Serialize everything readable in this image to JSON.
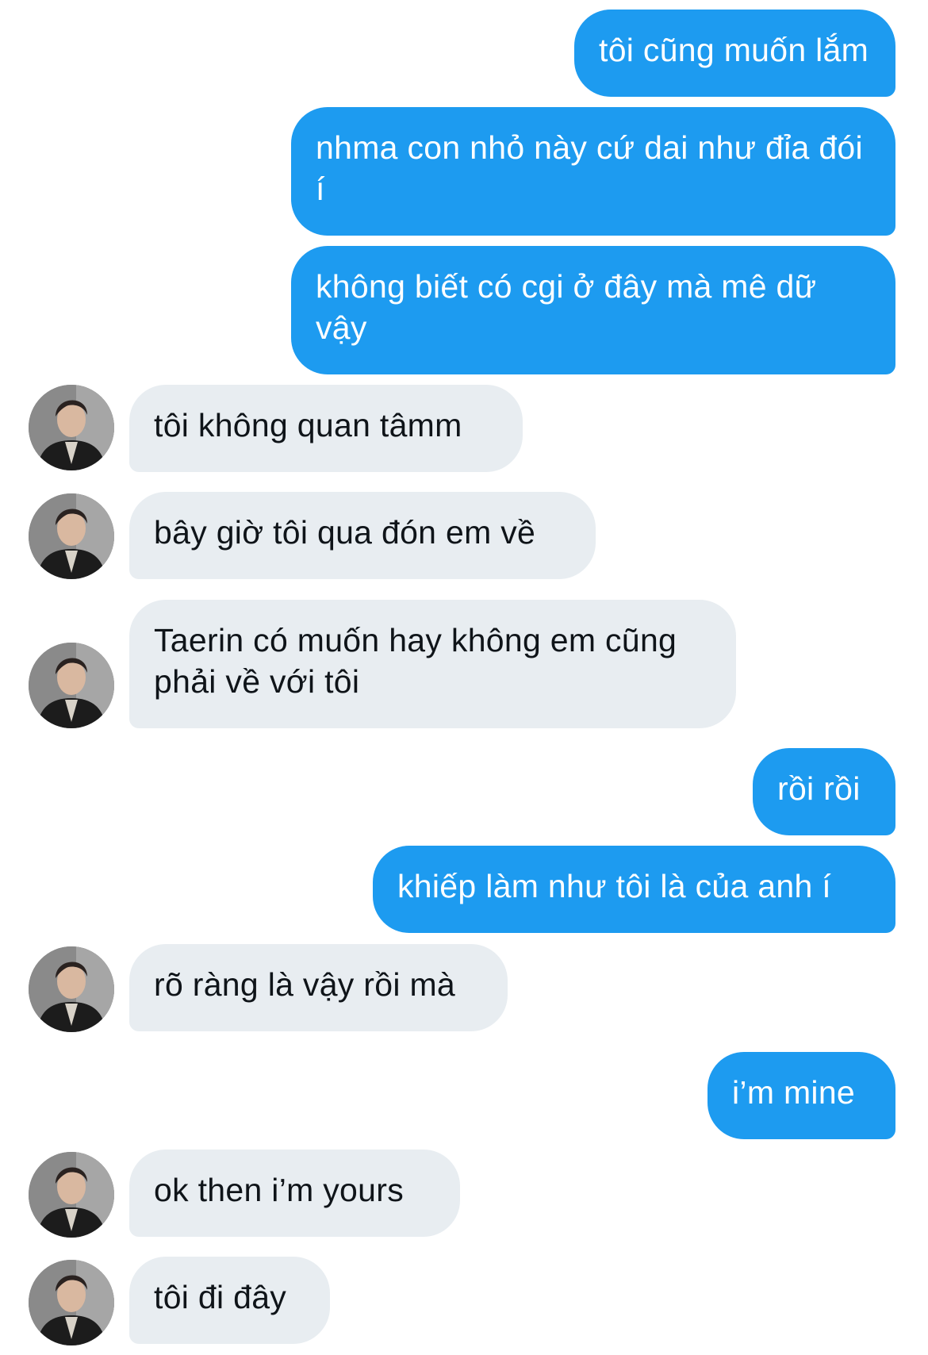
{
  "conversation": {
    "messages": [
      {
        "from": "me",
        "text": "tôi cũng muốn lắm"
      },
      {
        "from": "me",
        "text": "nhma con nhỏ này cứ dai như đỉa đói í"
      },
      {
        "from": "me",
        "text": "không biết có cgi ở đây mà mê dữ vậy"
      },
      {
        "from": "them",
        "text": "tôi không quan tâmm"
      },
      {
        "from": "them",
        "text": "bây giờ tôi qua đón em về"
      },
      {
        "from": "them",
        "text": "Taerin có muốn hay không em cũng phải về với tôi"
      },
      {
        "from": "me",
        "text": "rồi rồi"
      },
      {
        "from": "me",
        "text": "khiếp làm như tôi là của anh í"
      },
      {
        "from": "them",
        "text": "rõ ràng là vậy rồi mà"
      },
      {
        "from": "me",
        "text": "i’m mine"
      },
      {
        "from": "them",
        "text": "ok then i’m yours"
      },
      {
        "from": "them",
        "text": "tôi đi đây"
      }
    ]
  },
  "colors": {
    "sent_bubble": "#1d9bf0",
    "received_bubble": "#e8edf1",
    "background": "#ffffff"
  },
  "icons": {
    "avatar": "contact-avatar-photo"
  }
}
